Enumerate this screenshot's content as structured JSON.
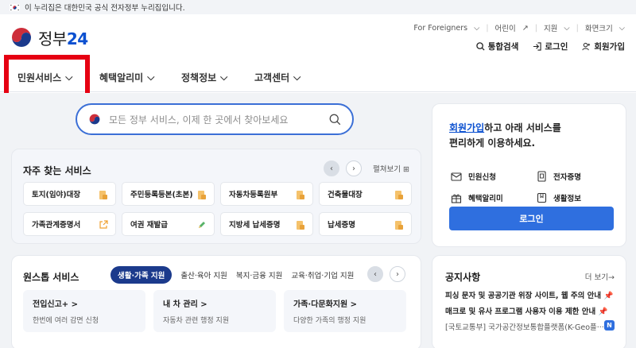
{
  "gov_banner": {
    "text": "이 누리집은 대한민국 공식 전자정부 누리집입니다."
  },
  "logo": {
    "text_main": "정부",
    "text_num": "24"
  },
  "util_links": [
    "For Foreigners",
    "어린이",
    "지원",
    "화면크기"
  ],
  "util_actions": {
    "search": "통합검색",
    "login": "로그인",
    "signup": "회원가입"
  },
  "gnb": [
    "민원서비스",
    "혜택알리미",
    "정책정보",
    "고객센터"
  ],
  "search": {
    "placeholder": "모든 정부 서비스, 이제 한 곳에서 찾아보세요"
  },
  "favorites": {
    "title": "자주 찾는 서비스",
    "unfold": "펼쳐보기",
    "items": [
      "토지(임야)대장",
      "주민등록등본(초본)",
      "자동차등록원부",
      "건축물대장",
      "가족관계증명서",
      "여권 재발급",
      "지방세 납세증명",
      "납세증명"
    ]
  },
  "onestop": {
    "title": "원스톱 서비스",
    "tabs": [
      "생활·가족 지원",
      "출산·육아 지원",
      "복지·금융 지원",
      "교육·취업·기업 지원"
    ],
    "cards": [
      {
        "title": "전입신고+ >",
        "desc": "한번에 여러 감면 신청"
      },
      {
        "title": "내 차 관리 >",
        "desc": "자동차 관련 행정 지원"
      },
      {
        "title": "가족·다문화지원 >",
        "desc": "다양한 가족의 행정 지원"
      }
    ]
  },
  "login_box": {
    "link": "회원가입",
    "line1_rest": "하고 아래 서비스를",
    "line2": "편리하게 이용하세요.",
    "quick": [
      "민원신청",
      "전자증명",
      "혜택알리미",
      "생활정보"
    ],
    "button": "로그인"
  },
  "notice": {
    "title": "공지사항",
    "more": "더 보기→",
    "items": [
      "피싱 문자 및 공공기관 위장 사이트, 웹 주의 안내",
      "매크로 및 유사 프로그램 사용자 이용 제한 안내",
      "[국토교통부] 국가공간정보통합플랫폼(K-Geo플···"
    ],
    "badge": "N"
  },
  "colors": {
    "accent": "#0b50d0",
    "button": "#2f6fdf",
    "highlight": "#e60012",
    "tab_active": "#1b3a8c"
  }
}
